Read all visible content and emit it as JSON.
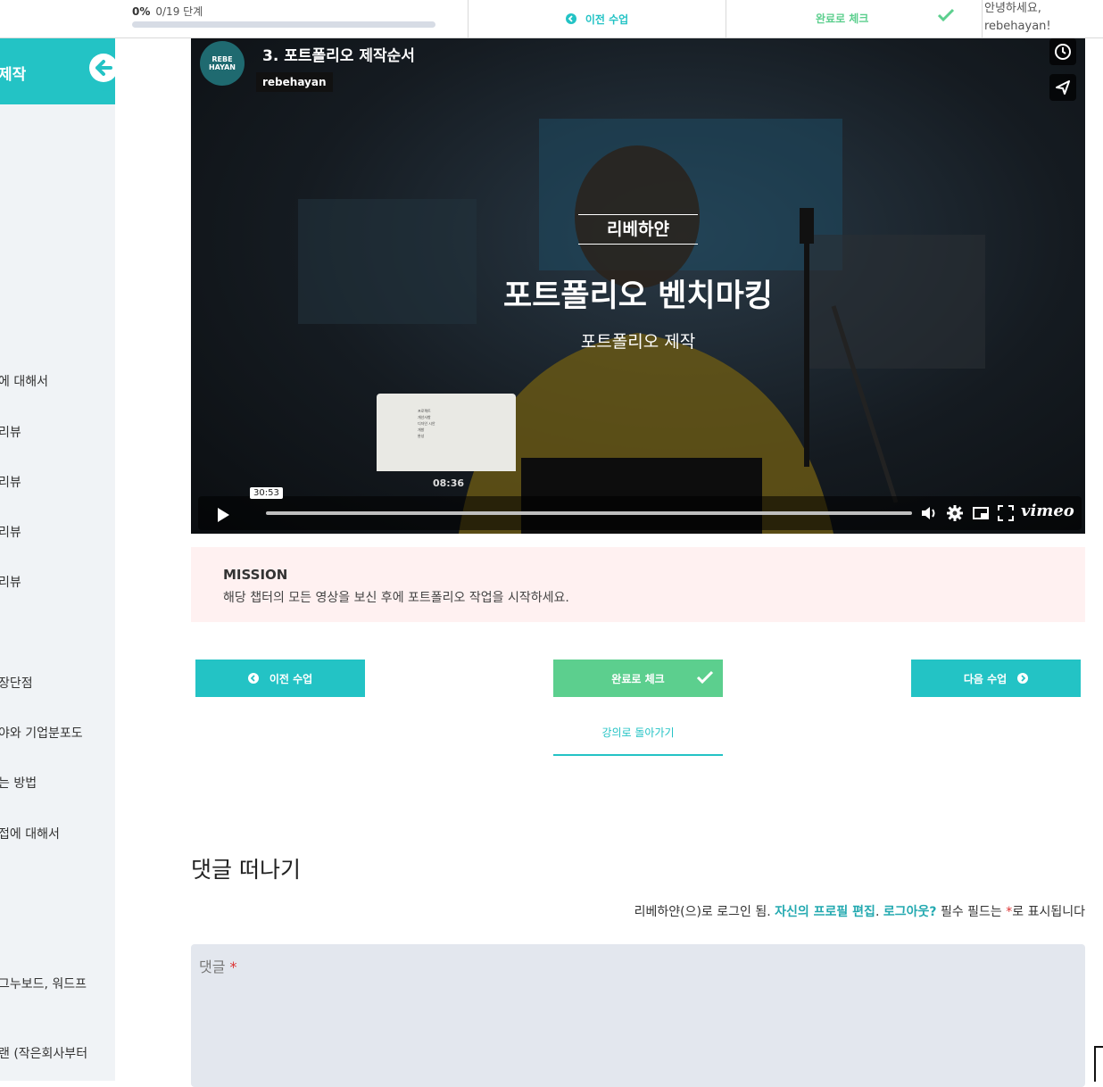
{
  "topbar": {
    "progress_percent": "0%",
    "progress_steps": "0/19 단계",
    "progress_fraction": 0,
    "prev_label": "이전 수업",
    "complete_label": "완료로 체크",
    "greeting_line1": "안녕하세요,",
    "greeting_line2": "rebehayan!"
  },
  "sidebar": {
    "title": "제작",
    "items": [
      {
        "label": "에 대해서"
      },
      {
        "label": "리뷰"
      },
      {
        "label": "리뷰"
      },
      {
        "label": "리뷰"
      },
      {
        "label": "리뷰"
      },
      {
        "label": "장단점"
      },
      {
        "label": "야와 기업분포도"
      },
      {
        "label": "는 방법"
      },
      {
        "label": "접에 대해서"
      },
      {
        "label": "그누보드, 워드프"
      },
      {
        "label": "랜 (작은회사부터"
      }
    ]
  },
  "video": {
    "channel_logo_line1": "REBE",
    "channel_logo_line2": "HAYAN",
    "title": "3. 포트폴리오 제작순서",
    "channel": "rebehayan",
    "slide_brand": "리베하얀",
    "slide_title": "포트폴리오 벤치마킹",
    "slide_subtitle": "포트폴리오 제작",
    "thumb_lines": [
      "프로젝트",
      "개선사항",
      "디자인 시안",
      "개발",
      "완성"
    ],
    "hover_time": "08:36",
    "current_time": "30:53",
    "brand": "vimeo"
  },
  "mission": {
    "title": "MISSION",
    "text": "해당 챕터의 모든 영상을 보신 후에 포트폴리오 작업을 시작하세요."
  },
  "nav": {
    "prev_label": "이전 수업",
    "complete_label": "완료로 체크",
    "next_label": "다음 수업",
    "back_label": "강의로 돌아가기"
  },
  "comments": {
    "heading": "댓글 떠나기",
    "login_prefix": "리베하얀(으)로 로그인 됨.",
    "edit_profile": "자신의 프로필 편집",
    "period": ".",
    "logout": "로그아웃?",
    "required_prefix": "필수 필드는",
    "required_star": "*",
    "required_suffix": "로 표시됩니다",
    "field_label": "댓글",
    "field_star": "*"
  },
  "colors": {
    "teal": "#23c3c5",
    "green": "#5ccf8e",
    "mission_bg": "#fff1f1",
    "sidebar_bg": "#f0f3f6"
  }
}
